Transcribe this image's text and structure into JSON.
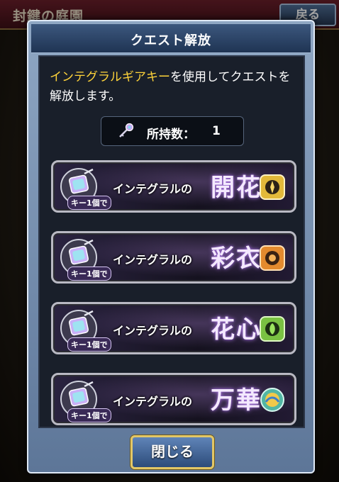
{
  "background": {
    "header_title": "封鍵の庭園",
    "back_button_label": "戻る"
  },
  "dialog": {
    "title": "クエスト解放",
    "description_highlight": "インテグラルギアキー",
    "description_rest": "を使用してクエストを解放します。",
    "owned_label": "所持数：",
    "owned_value": "1",
    "close_button_label": "閉じる"
  },
  "quests": [
    {
      "prefix": "インテグラルの",
      "name": "開花",
      "cost_tag": "キー1個で",
      "badge_color": "#e2b93a"
    },
    {
      "prefix": "インテグラルの",
      "name": "彩衣",
      "cost_tag": "キー1個で",
      "badge_color": "#e38a2e"
    },
    {
      "prefix": "インテグラルの",
      "name": "花心",
      "cost_tag": "キー1個で",
      "badge_color": "#7ac142"
    },
    {
      "prefix": "インテグラルの",
      "name": "万華",
      "cost_tag": "キー1個で",
      "badge_color": "#52b6a4"
    }
  ],
  "icons": {
    "key": "integral-gear-key-icon",
    "gem": "key-gem-icon",
    "badge": "element-badge-icon"
  }
}
